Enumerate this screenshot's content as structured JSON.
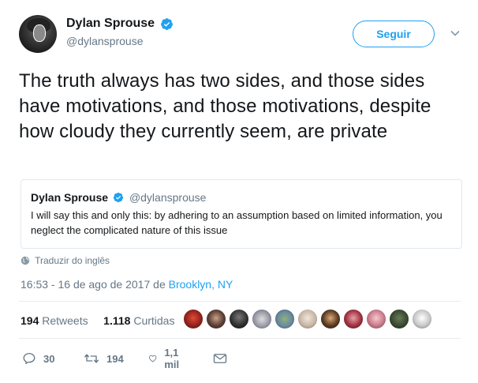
{
  "tweet": {
    "author": {
      "name": "Dylan Sprouse",
      "handle": "@dylansprouse",
      "verified": true
    },
    "follow_label": "Seguir",
    "text": "The truth always has two sides, and those sides have motivations, and those motivations, despite how cloudy they currently seem, are private",
    "quoted": {
      "name": "Dylan Sprouse",
      "handle": "@dylansprouse",
      "text": "I will say this and only this: by adhering to an assumption based on limited information, you neglect the complicated nature of this issue"
    },
    "translate_label": "Traduzir do inglês",
    "timestamp": "16:53 - 16 de ago de 2017",
    "from_word": "de",
    "location": "Brooklyn, NY",
    "retweets_count": "194",
    "retweets_label": "Retweets",
    "likes_count": "1.118",
    "likes_label": "Curtidas",
    "actions": {
      "reply_count": "30",
      "retweet_count": "194",
      "like_count": "1,1 mil"
    }
  },
  "colors": {
    "accent": "#1da1f2",
    "secondary_text": "#657786",
    "primary_text": "#14171a",
    "border": "#e1e8ed"
  },
  "icons": [
    "verified-badge-icon",
    "chevron-down-icon",
    "globe-icon",
    "reply-icon",
    "retweet-icon",
    "heart-icon",
    "mail-icon"
  ]
}
